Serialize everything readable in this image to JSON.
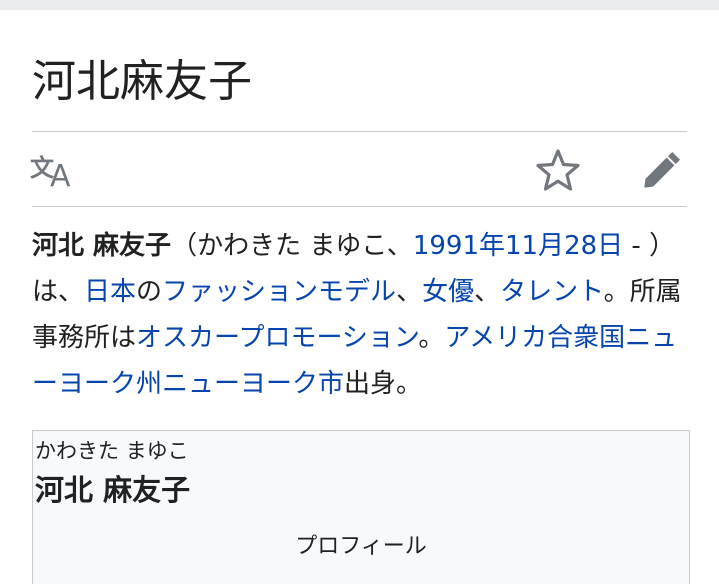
{
  "page": {
    "title": "河北麻友子"
  },
  "actions": {
    "language_icon": "language-icon",
    "watch_icon": "star-icon",
    "edit_icon": "pencil-icon"
  },
  "lead": {
    "name_bold": "河北 麻友子",
    "reading": "（かわきた まゆこ、",
    "birth_link": "1991年11月28日",
    "dash": " - ）",
    "is": "は、",
    "country_link": "日本",
    "no": "の",
    "model_link": "ファッションモデル",
    "comma1": "、",
    "actress_link": "女優",
    "comma2": "、",
    "talent_link": "タレント",
    "agency_text": "。所属事務所は",
    "agency_link": "オスカープロモーション",
    "period": "。",
    "birthplace_link": "アメリカ合衆国ニューヨーク州ニューヨーク市",
    "origin": "出身。"
  },
  "infobox": {
    "kana": "かわきた まゆこ",
    "name": "河北 麻友子",
    "section": "プロフィール"
  },
  "colors": {
    "link": "#0645ad",
    "text": "#202122",
    "icon": "#72777d",
    "border": "#c8ccd1"
  }
}
